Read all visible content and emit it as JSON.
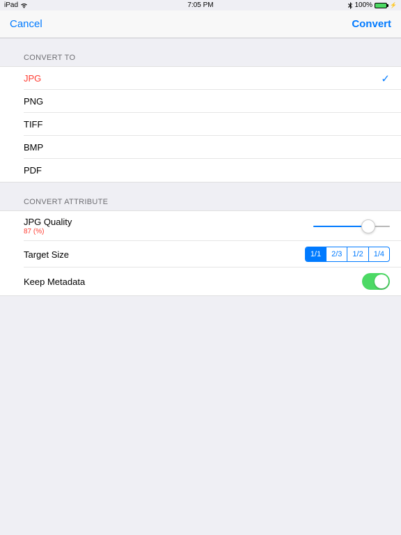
{
  "status": {
    "device": "iPad",
    "time": "7:05 PM",
    "battery": "100%"
  },
  "nav": {
    "cancel": "Cancel",
    "convert": "Convert"
  },
  "sections": {
    "convert_to": "CONVERT TO",
    "convert_attribute": "CONVERT ATTRIBUTE"
  },
  "formats": {
    "items": [
      "JPG",
      "PNG",
      "TIFF",
      "BMP",
      "PDF"
    ],
    "selected_index": 0
  },
  "attributes": {
    "jpg_quality_label": "JPG Quality",
    "jpg_quality_value": "87 (%)",
    "jpg_quality_percent": 87,
    "target_size_label": "Target Size",
    "target_size_options": [
      "1/1",
      "2/3",
      "1/2",
      "1/4"
    ],
    "target_size_selected": 0,
    "keep_metadata_label": "Keep Metadata",
    "keep_metadata_on": true
  }
}
